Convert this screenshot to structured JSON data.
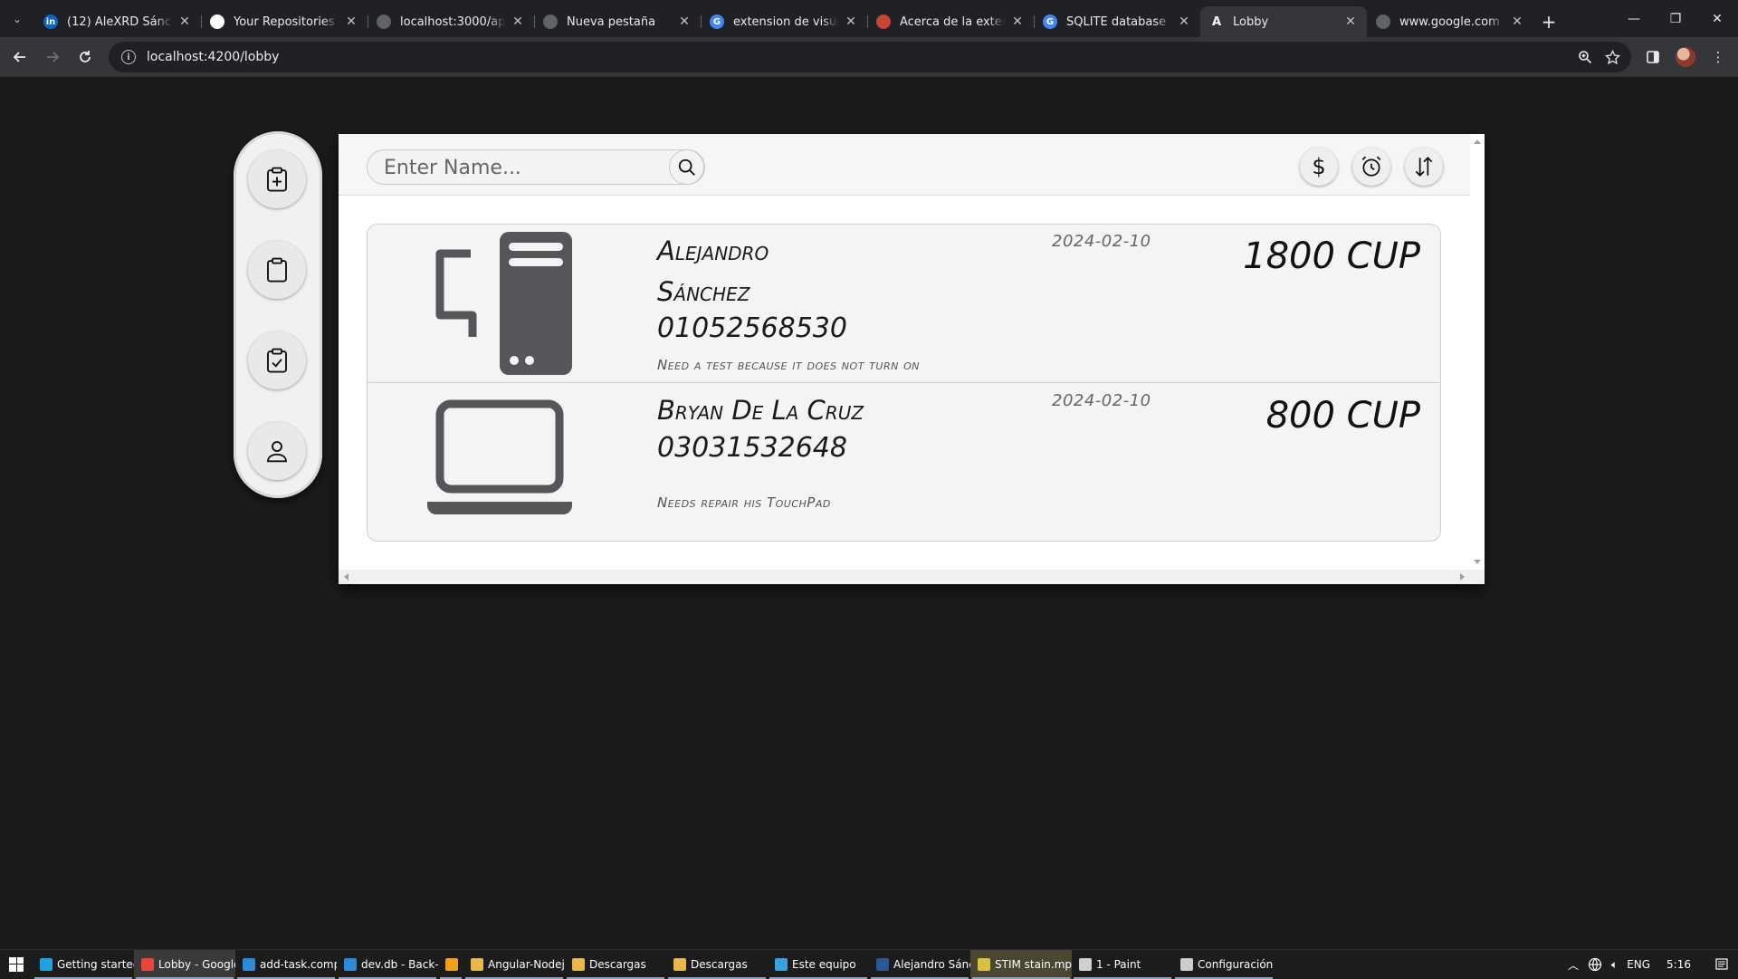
{
  "browser": {
    "tabs": [
      {
        "title": "(12) AleXRD Sánchez",
        "fav": "in",
        "fav_color": "#0a66c2"
      },
      {
        "title": "Your Repositories",
        "fav": "",
        "fav_color": "#ffffff"
      },
      {
        "title": "localhost:3000/api/cli",
        "fav": "",
        "fav_color": "#5f6368"
      },
      {
        "title": "Nueva pestaña",
        "fav": "",
        "fav_color": "#5f6368"
      },
      {
        "title": "extension de visual st",
        "fav": "G",
        "fav_color": "#4285f4"
      },
      {
        "title": "Acerca de la extensió",
        "fav": "",
        "fav_color": "#c74634"
      },
      {
        "title": "SQLITE database view",
        "fav": "G",
        "fav_color": "#4285f4"
      },
      {
        "title": "Lobby",
        "fav": "A",
        "fav_color": "#35363a"
      },
      {
        "title": "www.google.com",
        "fav": "",
        "fav_color": "#5f6368"
      }
    ],
    "active_tab_index": 7,
    "url": "localhost:4200/lobby"
  },
  "app": {
    "search": {
      "placeholder": "Enter Name...",
      "value": ""
    },
    "filters": [
      {
        "name": "price-filter-button",
        "glyph": "$"
      },
      {
        "name": "date-filter-button",
        "glyph": "alarm"
      },
      {
        "name": "sort-button",
        "glyph": "sort"
      }
    ],
    "sidebar": [
      {
        "name": "add-task-button",
        "icon": "clipboard-plus-icon"
      },
      {
        "name": "tasks-button",
        "icon": "clipboard-icon"
      },
      {
        "name": "completed-tasks-button",
        "icon": "clipboard-check-icon"
      },
      {
        "name": "profile-button",
        "icon": "person-icon"
      }
    ],
    "cards": [
      {
        "device": "desktop",
        "name_line1": "Alejandro",
        "name_line2": "Sánchez",
        "phone": "01052568530",
        "description": "Need a test because it does not turn on",
        "date": "2024-02-10",
        "price": "1800 CUP"
      },
      {
        "device": "laptop",
        "name_line1": "Bryan De La Cruz",
        "name_line2": "",
        "phone": "03031532648",
        "description": "Needs repair his TouchPad",
        "date": "2024-02-10",
        "price": "800 CUP"
      }
    ]
  },
  "taskbar": {
    "items": [
      {
        "label": "Getting started wi...",
        "color": "#1fa2e0",
        "state": "normal"
      },
      {
        "label": "Lobby - Google C...",
        "color": "#e8453c",
        "state": "active"
      },
      {
        "label": "add-task.compon...",
        "color": "#2c8ad8",
        "state": "normal"
      },
      {
        "label": "dev.db - Back-En...",
        "color": "#2c8ad8",
        "state": "normal"
      },
      {
        "label": "",
        "color": "#f0a020",
        "state": "normal"
      },
      {
        "label": "Angular-Nodejs-...",
        "color": "#e8b84a",
        "state": "normal"
      },
      {
        "label": "Descargas",
        "color": "#e8b84a",
        "state": "normal"
      },
      {
        "label": "Descargas",
        "color": "#e8b84a",
        "state": "normal"
      },
      {
        "label": "Este equipo",
        "color": "#3aa0e0",
        "state": "normal"
      },
      {
        "label": "Alejandro Sánche...",
        "color": "#2b5797",
        "state": "normal"
      },
      {
        "label": "STIM stain.mp4",
        "color": "#d8c040",
        "state": "yellow"
      },
      {
        "label": "1 - Paint",
        "color": "#d0d0d0",
        "state": "normal"
      },
      {
        "label": "Configuración",
        "color": "#cccccc",
        "state": "normal"
      }
    ],
    "lang": "ENG",
    "time": "5:16"
  }
}
